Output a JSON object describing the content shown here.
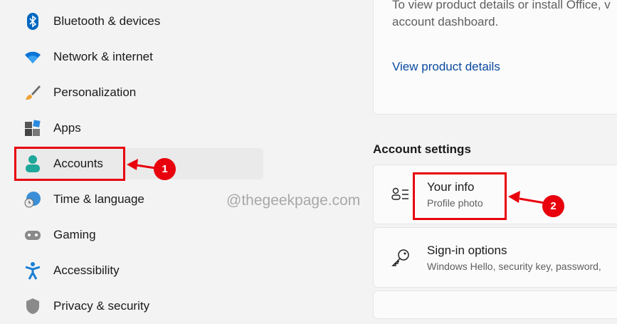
{
  "sidebar": {
    "items": [
      {
        "label": "Bluetooth & devices",
        "icon": "bluetooth-icon"
      },
      {
        "label": "Network & internet",
        "icon": "wifi-icon"
      },
      {
        "label": "Personalization",
        "icon": "brush-icon"
      },
      {
        "label": "Apps",
        "icon": "apps-icon"
      },
      {
        "label": "Accounts",
        "icon": "person-icon",
        "active": true
      },
      {
        "label": "Time & language",
        "icon": "globe-clock-icon"
      },
      {
        "label": "Gaming",
        "icon": "gamepad-icon"
      },
      {
        "label": "Accessibility",
        "icon": "accessibility-icon"
      },
      {
        "label": "Privacy & security",
        "icon": "shield-icon"
      }
    ]
  },
  "office_card": {
    "text_line1": "To view product details or install Office, v",
    "text_line2": "account dashboard.",
    "link": "View product details"
  },
  "account_settings": {
    "heading": "Account settings",
    "items": [
      {
        "title": "Your info",
        "subtitle": "Profile photo",
        "icon": "person-list-icon"
      },
      {
        "title": "Sign-in options",
        "subtitle": "Windows Hello, security key, password,",
        "icon": "key-icon"
      }
    ]
  },
  "annotations": {
    "step1": "1",
    "step2": "2",
    "watermark": "@thegeekpage.com",
    "color": "#e8000d"
  }
}
